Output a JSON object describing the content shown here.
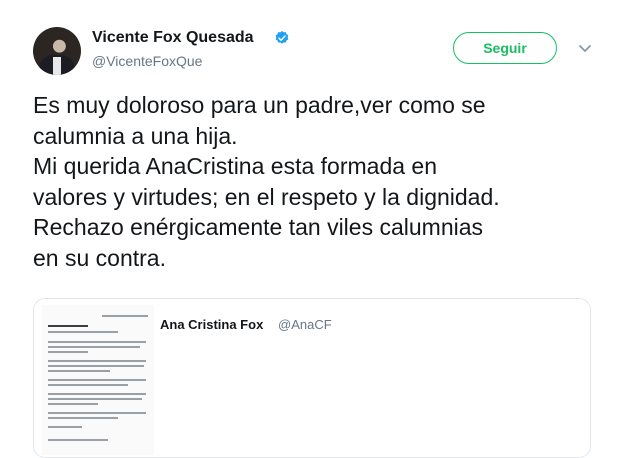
{
  "author": {
    "name": "Vicente Fox Quesada",
    "handle": "@VicenteFoxQue",
    "verified": true,
    "avatar_icon": "profile-photo"
  },
  "actions": {
    "follow_label": "Seguir",
    "follow_color": "#17bf63",
    "more_icon": "chevron-down-icon"
  },
  "tweet": {
    "lines": [
      "Es muy doloroso para un padre,ver como se",
      "calumnia a una hija.",
      "Mi querida AnaCristina esta formada en",
      "valores y virtudes; en el respeto y la dignidad.",
      "Rechazo enérgicamente tan viles calumnias",
      "en su contra."
    ]
  },
  "quoted_tweet": {
    "name": "Ana Cristina Fox",
    "handle": "@AnaCF",
    "media_icon": "document-image"
  },
  "colors": {
    "text": "#14171a",
    "secondary": "#657786",
    "verified_blue": "#1da1f2",
    "border": "#e1e8ed"
  }
}
